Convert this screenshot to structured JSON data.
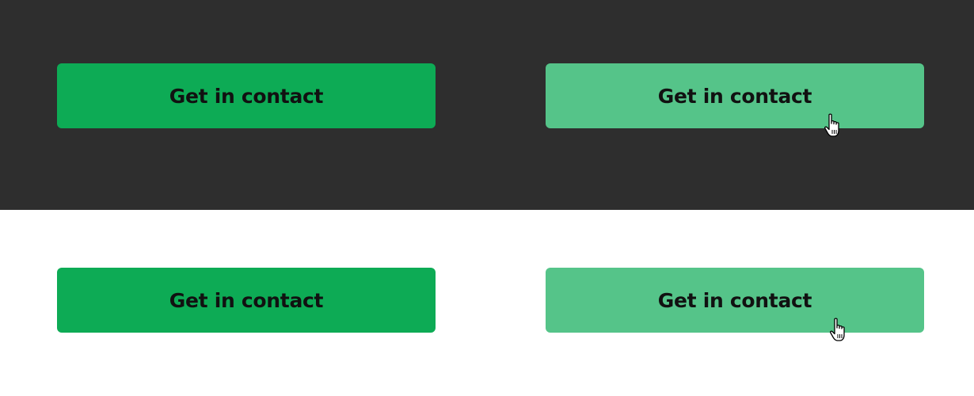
{
  "colors": {
    "dark_background": "#2e2e2e",
    "light_background": "#ffffff",
    "button_default": "#0dab55",
    "button_hover": "#55c489",
    "button_text": "#111111"
  },
  "dark_panel": {
    "default_button_label": "Get in contact",
    "hover_button_label": "Get in contact"
  },
  "light_panel": {
    "default_button_label": "Get in contact",
    "hover_button_label": "Get in contact"
  },
  "cursor": {
    "icon": "hand-pointer-icon"
  }
}
